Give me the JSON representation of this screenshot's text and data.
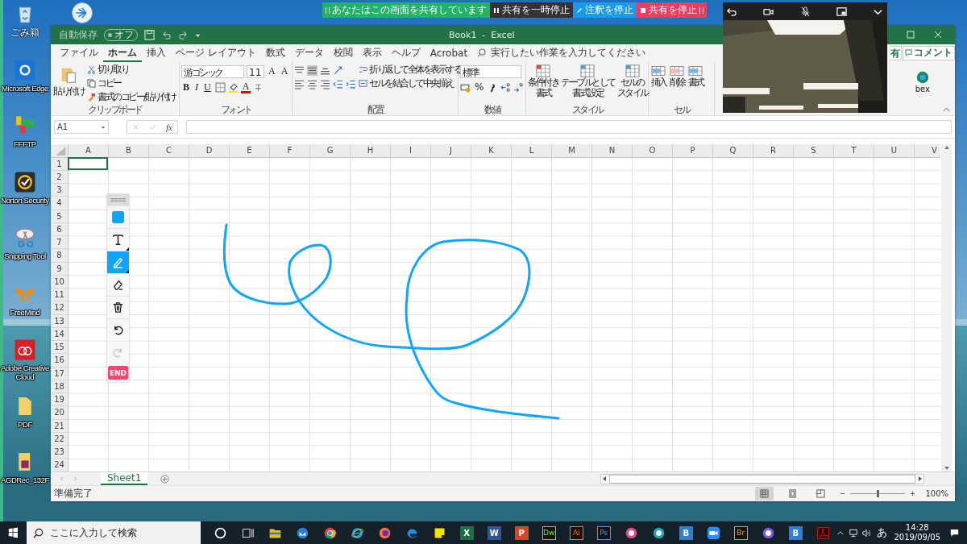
{
  "desktop_icons": [
    {
      "kind": "trash",
      "label": "ごみ箱"
    },
    {
      "kind": "edge",
      "label": "Microsoft Edge"
    },
    {
      "kind": "ftp",
      "label": "FFFTP"
    },
    {
      "kind": "norton",
      "label": "Norton Security"
    },
    {
      "kind": "snip",
      "label": "Snipping Tool"
    },
    {
      "kind": "butterfly",
      "label": "FreeMind"
    },
    {
      "kind": "cc",
      "label": "Adobe Creative Cloud"
    },
    {
      "kind": "folder",
      "label": "PDF"
    },
    {
      "kind": "rec",
      "label": "AGDRec_132F"
    }
  ],
  "share_bar": {
    "status": "あなたはこの画面を共有しています",
    "pause": "共有を一時停止",
    "annotate": "注釈を停止",
    "stop": "共有を停止"
  },
  "excel": {
    "autosave_label": "自動保存",
    "autosave_state": "オフ",
    "title": "Book1  -  Excel",
    "tabs": [
      {
        "label": "ファイル",
        "selected": false
      },
      {
        "label": "ホーム",
        "selected": true
      },
      {
        "label": "挿入",
        "selected": false
      },
      {
        "label": "ページ レイアウト",
        "selected": false
      },
      {
        "label": "数式",
        "selected": false
      },
      {
        "label": "データ",
        "selected": false
      },
      {
        "label": "校閲",
        "selected": false
      },
      {
        "label": "表示",
        "selected": false
      },
      {
        "label": "ヘルプ",
        "selected": false
      },
      {
        "label": "Acrobat",
        "selected": false
      }
    ],
    "search_placeholder": "実行したい作業を入力してください",
    "share": "有",
    "comment": "コメント",
    "clipboard": {
      "paste": "貼り付け",
      "cut": "切り取り",
      "copy": "コピー",
      "format_painter": "書式のコピー/貼り付け",
      "label": "クリップボード"
    },
    "font": {
      "name": "游ゴシック",
      "size": "11",
      "grow": "A",
      "shrink": "A",
      "styles": [
        "B",
        "I",
        "U"
      ],
      "color_letter": "A",
      "label": "フォント"
    },
    "alignment": {
      "wrap": "折り返して全体を表示する",
      "merge": "セルを結合して中央揃え",
      "label": "配置"
    },
    "number": {
      "format": "標準",
      "percent": "%",
      "label": "数値"
    },
    "styles": {
      "buttons": [
        {
          "lines": [
            "条件付き",
            "書式"
          ]
        },
        {
          "lines": [
            "テーブルとして",
            "書式設定"
          ]
        },
        {
          "lines": [
            "セルの",
            "スタイル"
          ]
        }
      ],
      "label": "スタイル"
    },
    "cells": {
      "buttons": [
        "挿入",
        "削除",
        "書式"
      ],
      "label": "セル"
    },
    "addin_label": "bex",
    "name_box": "A1",
    "fx": "fx",
    "columns": [
      "A",
      "B",
      "C",
      "D",
      "E",
      "F",
      "G",
      "H",
      "I",
      "J",
      "K",
      "L",
      "M",
      "N",
      "O",
      "P",
      "Q",
      "R",
      "S",
      "T",
      "U",
      "V"
    ],
    "rows": [
      "1",
      "2",
      "3",
      "4",
      "5",
      "6",
      "7",
      "8",
      "9",
      "10",
      "11",
      "12",
      "13",
      "14",
      "15",
      "16",
      "17",
      "18",
      "19",
      "20",
      "21",
      "22",
      "23",
      "24"
    ],
    "sheet_tabs": [
      {
        "label": "Sheet1",
        "selected": true
      }
    ],
    "status": "準備完了",
    "zoom": {
      "level": 0.5,
      "reading": "100%"
    }
  },
  "annotation_tools": [
    {
      "kind": "color",
      "color": "#0ea5ff",
      "selected": false,
      "disabled": false
    },
    {
      "kind": "text",
      "selected": false,
      "disabled": false
    },
    {
      "kind": "pen",
      "selected": true,
      "disabled": false
    },
    {
      "kind": "eraser",
      "selected": false,
      "disabled": false
    },
    {
      "kind": "trash",
      "selected": false,
      "disabled": false
    },
    {
      "kind": "undo",
      "selected": false,
      "disabled": false
    },
    {
      "kind": "redo",
      "selected": false,
      "disabled": true
    }
  ],
  "annotation_end": "END",
  "taskbar": {
    "search_placeholder": "ここに入力して検索",
    "apps": [
      {
        "kind": "ring"
      },
      {
        "kind": "taskview"
      },
      {
        "kind": "folder"
      },
      {
        "kind": "mail"
      },
      {
        "kind": "chrome"
      },
      {
        "kind": "ie"
      },
      {
        "kind": "firefox"
      },
      {
        "kind": "edge"
      },
      {
        "kind": "note"
      },
      {
        "kind": "tile",
        "text": "X",
        "color": "#1d6f42"
      },
      {
        "kind": "tile",
        "text": "W",
        "color": "#2b579a"
      },
      {
        "kind": "tile",
        "text": "P",
        "color": "#d24726"
      },
      {
        "kind": "framed",
        "text": "Dw",
        "color": "#4aff00"
      },
      {
        "kind": "framed",
        "text": "Ai",
        "color": "#ff7c00"
      },
      {
        "kind": "framed",
        "text": "Ps",
        "color": "#31a8ff"
      },
      {
        "kind": "orb",
        "color": "#e04a8c"
      },
      {
        "kind": "orb",
        "color": "#1aa6b7"
      },
      {
        "kind": "tile",
        "text": "B",
        "color": "#2d7fd3"
      },
      {
        "kind": "zoom"
      },
      {
        "kind": "framed",
        "text": "Br",
        "color": "#e8a30d"
      },
      {
        "kind": "orb",
        "color": "#7b5cd6"
      },
      {
        "kind": "tile",
        "text": "B",
        "color": "#2d7fd3"
      },
      {
        "kind": "pdf"
      }
    ],
    "ime": "あ",
    "time": "14:28",
    "date": "2019/09/05"
  }
}
